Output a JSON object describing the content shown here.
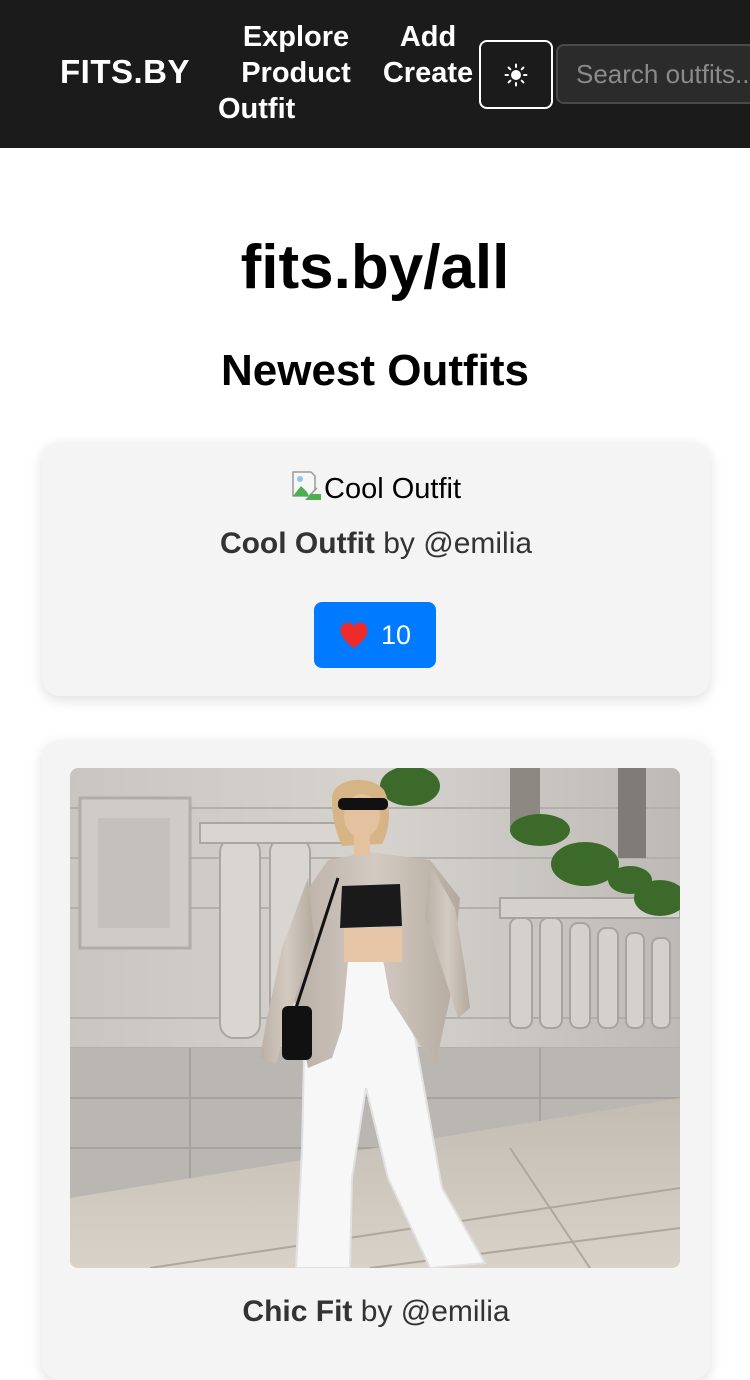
{
  "navbar": {
    "brand": "FITS.BY",
    "explore_line1": "Explore",
    "explore_line2": "Product",
    "explore_line3": "Outfit",
    "add_line1": "Add",
    "add_line2": "Create",
    "theme_icon": "sun-icon",
    "search_placeholder": "Search outfits..."
  },
  "main": {
    "title": "fits.by/all",
    "section_title": "Newest Outfits"
  },
  "outfits": [
    {
      "image_alt": "Cool Outfit",
      "name": "Cool Outfit",
      "by_text": " by @emilia",
      "likes": "10",
      "like_icon": "heart-icon",
      "like_button_color": "#007bff",
      "heart_color": "#ee2b2b"
    },
    {
      "name": "Chic Fit",
      "by_text": " by @emilia"
    }
  ],
  "colors": {
    "navbar_bg": "#1b1b1b",
    "card_bg": "#f4f4f4",
    "accent": "#007bff"
  }
}
